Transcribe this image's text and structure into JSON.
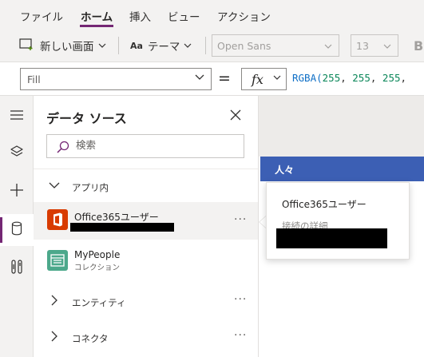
{
  "menu": {
    "items": [
      "ファイル",
      "ホーム",
      "挿入",
      "ビュー",
      "アクション"
    ],
    "active_index": 1
  },
  "toolbar": {
    "new_screen_label": "新しい画面",
    "theme_label": "テーマ",
    "font_family": "Open Sans",
    "font_size": "13",
    "truncated_bold": "B"
  },
  "formula_bar": {
    "property": "Fill",
    "equals": "=",
    "fx_label": "fx",
    "formula_fn": "RGBA(",
    "formula_args": [
      "255",
      "255",
      "255"
    ],
    "formula_sep": ", "
  },
  "rail": {
    "items": [
      "hamburger-icon",
      "layers-icon",
      "plus-icon",
      "database-icon",
      "tools-icon"
    ],
    "active_index": 3
  },
  "panel": {
    "title": "データ ソース",
    "search_placeholder": "検索",
    "section_in_app": "アプリ内",
    "data_sources": [
      {
        "name": "Office365ユーザー",
        "subtitle": "",
        "icon": "office-icon",
        "color": "#d83b01",
        "selected": true
      },
      {
        "name": "MyPeople",
        "subtitle": "コレクション",
        "icon": "collection-icon",
        "color": "#4ca88b",
        "selected": false
      }
    ],
    "section_entities": "エンティティ",
    "section_connectors": "コネクタ"
  },
  "canvas": {
    "header_title": "人々",
    "header_color": "#3c5fb4"
  },
  "callout": {
    "title": "Office365ユーザー",
    "subtitle": "接続の詳細"
  },
  "colors": {
    "accent": "#742774",
    "toolbar_bg": "#f3f2f1"
  }
}
